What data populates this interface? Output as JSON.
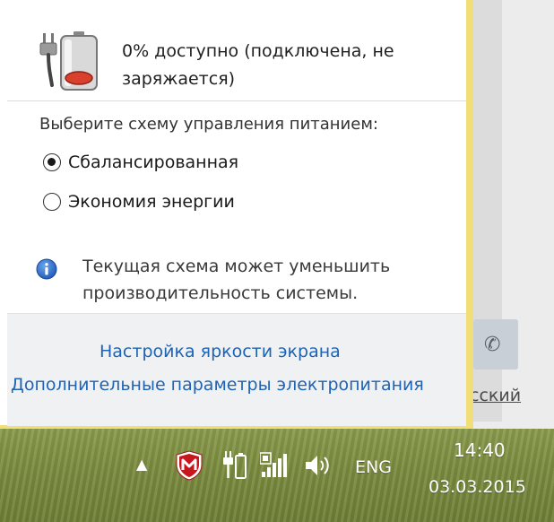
{
  "battery": {
    "status_line1": "0% доступно (подключена, не",
    "status_line2": "заряжается)"
  },
  "power_plan": {
    "heading": "Выберите схему управления питанием:",
    "options": [
      {
        "label": "Сбалансированная",
        "selected": true
      },
      {
        "label": "Экономия энергии",
        "selected": false
      }
    ]
  },
  "notice": {
    "line1": "Текущая схема может уменьшить",
    "line2": "производительность системы."
  },
  "links": {
    "brightness": "Настройка яркости экрана",
    "advanced": "Дополнительные параметры электропитания"
  },
  "background_window": {
    "language_link": "сский"
  },
  "taskbar": {
    "language": "ENG",
    "time": "14:40",
    "date": "03.03.2015",
    "icons": [
      "show-hidden-icons-arrow",
      "mcafee-icon",
      "power-plugged-icon",
      "network-signal-icon",
      "volume-icon"
    ]
  },
  "colors": {
    "flyout_frame": "#f1de78",
    "link": "#1e63b4",
    "taskbar": "#7b8c3f"
  }
}
